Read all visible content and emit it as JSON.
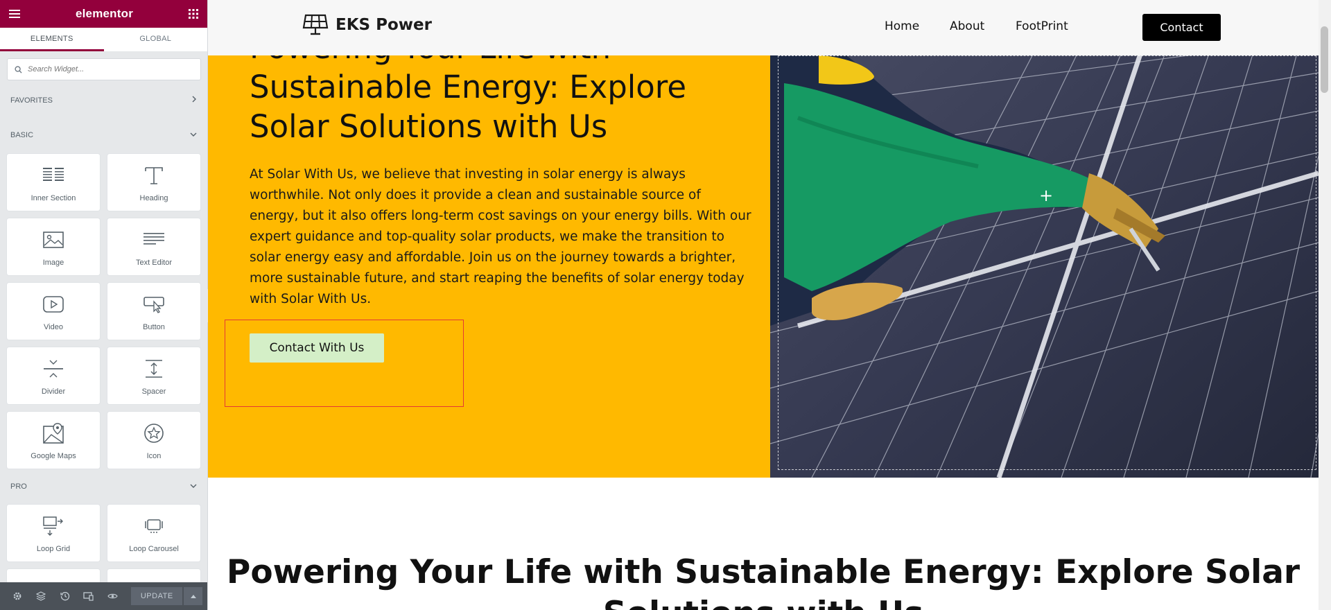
{
  "panel": {
    "logo": "elementor",
    "tabs": [
      "ELEMENTS",
      "GLOBAL"
    ],
    "search_placeholder": "Search Widget...",
    "categories": {
      "favorites": "FAVORITES",
      "basic": "BASIC",
      "pro": "PRO"
    },
    "basic_widgets": [
      "Inner Section",
      "Heading",
      "Image",
      "Text Editor",
      "Video",
      "Button",
      "Divider",
      "Spacer",
      "Google Maps",
      "Icon"
    ],
    "pro_widgets": [
      "Loop Grid",
      "Loop Carousel"
    ],
    "footer": {
      "update_label": "UPDATE"
    },
    "brand_color": "#93003c"
  },
  "site": {
    "brand": "EKS Power",
    "nav": [
      "Home",
      "About",
      "FootPrint"
    ],
    "nav_contact": "Contact",
    "hero": {
      "title": "Powering Your Life with Sustainable Energy: Explore Solar Solutions with Us",
      "text": "At Solar With Us, we believe that investing in solar energy is always worthwhile. Not only does it provide a clean and sustainable source of energy, but it also offers long-term cost savings on your energy bills. With our expert guidance and top-quality solar products, we make the transition to solar energy easy and affordable. Join us on the journey towards a brighter, more sustainable future, and start reaping the benefits of solar energy today with Solar With Us.",
      "button": "Contact With Us",
      "bg_color": "#ffb900",
      "button_color": "#d4efc7"
    },
    "section2_title": "Powering Your Life with Sustainable Energy: Explore Solar Solutions with Us"
  }
}
